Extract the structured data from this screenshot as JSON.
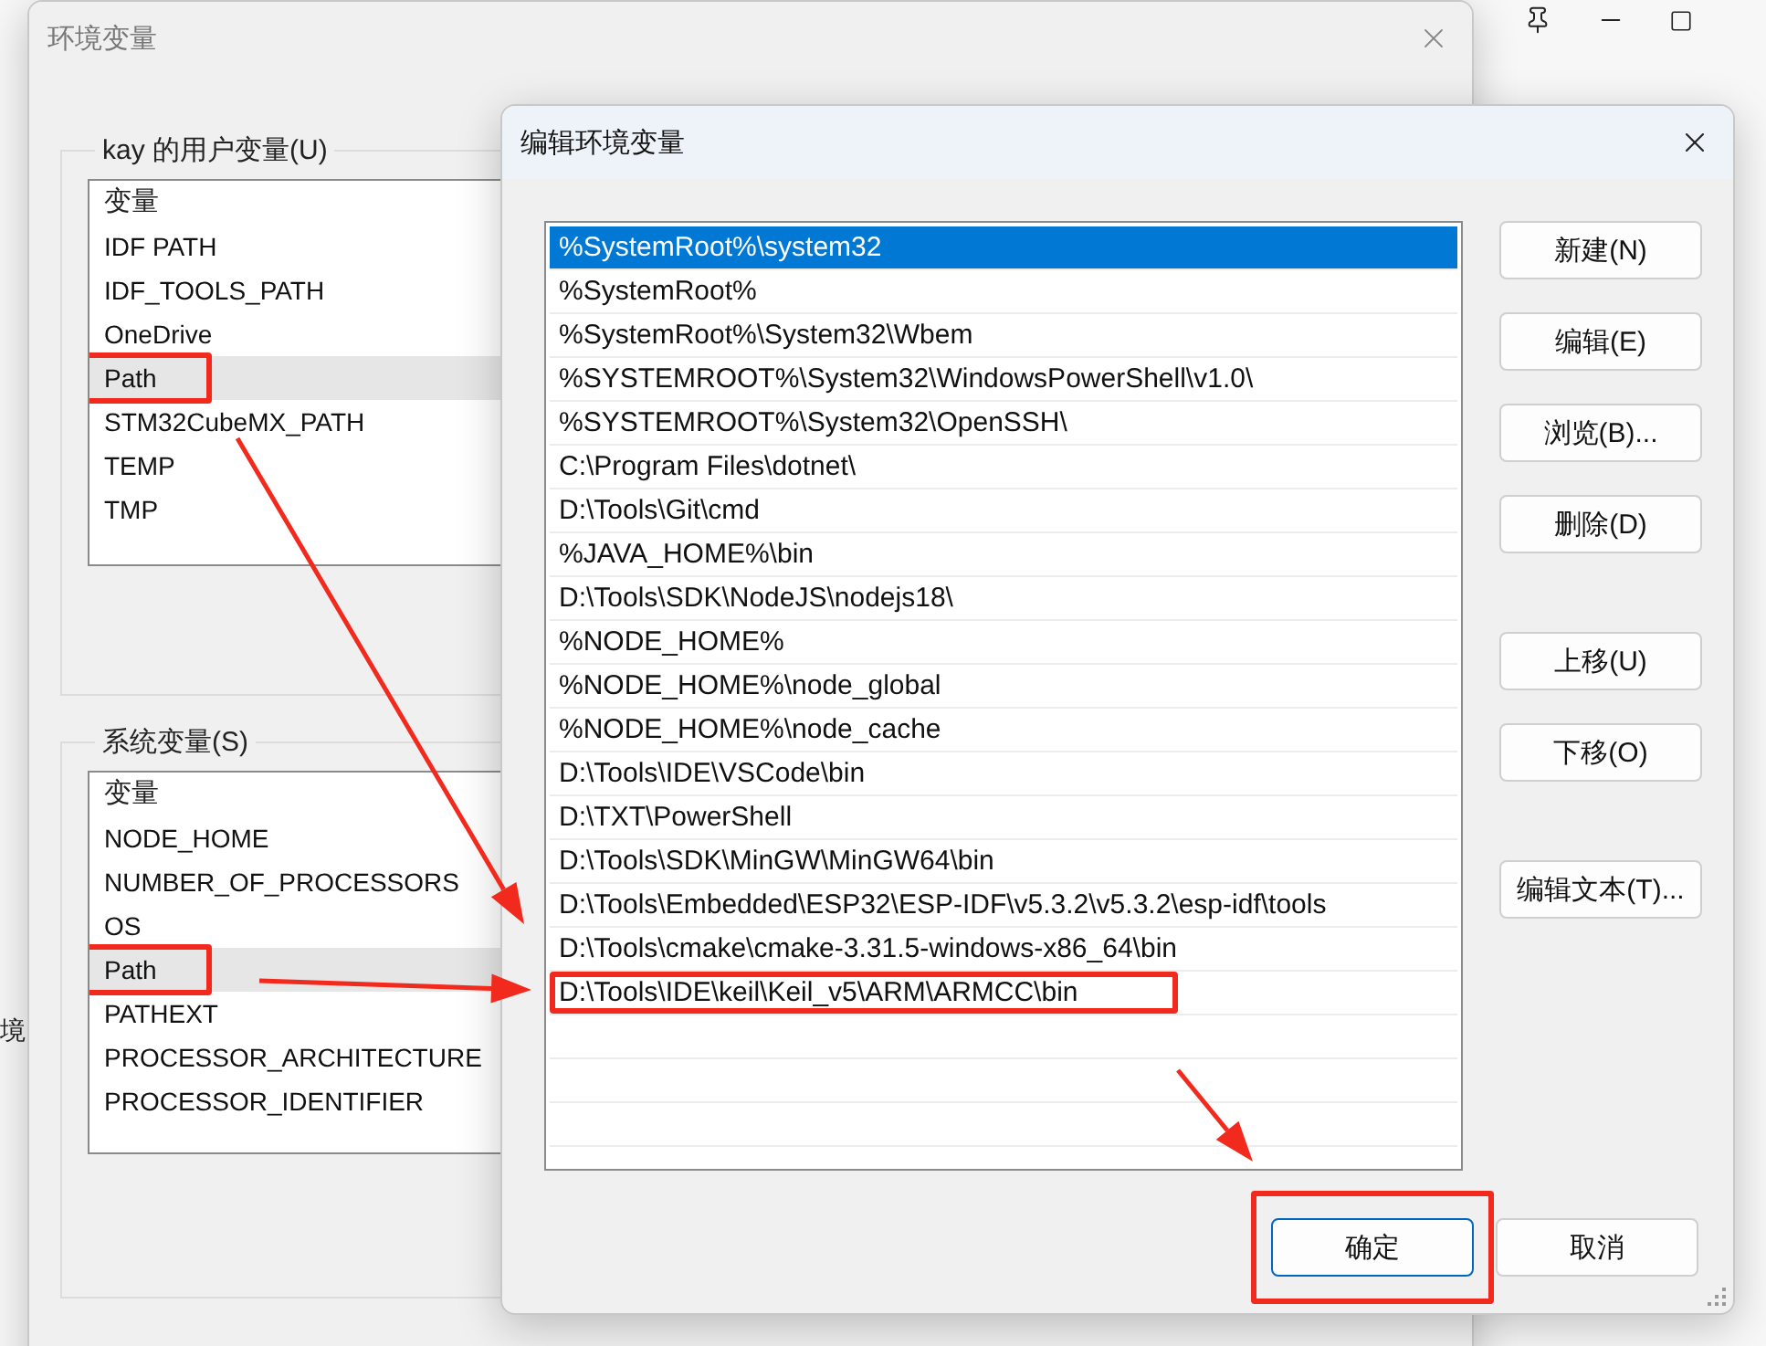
{
  "background_window": {
    "side_label": "境"
  },
  "env_window": {
    "title": "环境变量",
    "user_group": {
      "title": "kay 的用户变量(U)",
      "column": "变量",
      "rows": [
        {
          "name": "IDF PATH",
          "selected": false,
          "highlighted": false
        },
        {
          "name": "IDF_TOOLS_PATH",
          "selected": false,
          "highlighted": false
        },
        {
          "name": "OneDrive",
          "selected": false,
          "highlighted": false
        },
        {
          "name": "Path",
          "selected": true,
          "highlighted": true
        },
        {
          "name": "STM32CubeMX_PATH",
          "selected": false,
          "highlighted": false
        },
        {
          "name": "TEMP",
          "selected": false,
          "highlighted": false
        },
        {
          "name": "TMP",
          "selected": false,
          "highlighted": false
        }
      ]
    },
    "system_group": {
      "title": "系统变量(S)",
      "column": "变量",
      "rows": [
        {
          "name": "NODE_HOME",
          "selected": false,
          "highlighted": false
        },
        {
          "name": "NUMBER_OF_PROCESSORS",
          "selected": false,
          "highlighted": false
        },
        {
          "name": "OS",
          "selected": false,
          "highlighted": false
        },
        {
          "name": "Path",
          "selected": true,
          "highlighted": true
        },
        {
          "name": "PATHEXT",
          "selected": false,
          "highlighted": false
        },
        {
          "name": "PROCESSOR_ARCHITECTURE",
          "selected": false,
          "highlighted": false
        },
        {
          "name": "PROCESSOR_IDENTIFIER",
          "selected": false,
          "highlighted": false
        }
      ]
    }
  },
  "edit_dialog": {
    "title": "编辑环境变量",
    "entries": [
      {
        "text": "%SystemRoot%\\system32",
        "selected": true,
        "highlighted": false
      },
      {
        "text": "%SystemRoot%",
        "selected": false,
        "highlighted": false
      },
      {
        "text": "%SystemRoot%\\System32\\Wbem",
        "selected": false,
        "highlighted": false
      },
      {
        "text": "%SYSTEMROOT%\\System32\\WindowsPowerShell\\v1.0\\",
        "selected": false,
        "highlighted": false
      },
      {
        "text": "%SYSTEMROOT%\\System32\\OpenSSH\\",
        "selected": false,
        "highlighted": false
      },
      {
        "text": "C:\\Program Files\\dotnet\\",
        "selected": false,
        "highlighted": false
      },
      {
        "text": "D:\\Tools\\Git\\cmd",
        "selected": false,
        "highlighted": false
      },
      {
        "text": "%JAVA_HOME%\\bin",
        "selected": false,
        "highlighted": false
      },
      {
        "text": "D:\\Tools\\SDK\\NodeJS\\nodejs18\\",
        "selected": false,
        "highlighted": false
      },
      {
        "text": "%NODE_HOME%",
        "selected": false,
        "highlighted": false
      },
      {
        "text": "%NODE_HOME%\\node_global",
        "selected": false,
        "highlighted": false
      },
      {
        "text": "%NODE_HOME%\\node_cache",
        "selected": false,
        "highlighted": false
      },
      {
        "text": "D:\\Tools\\IDE\\VSCode\\bin",
        "selected": false,
        "highlighted": false
      },
      {
        "text": "D:\\TXT\\PowerShell",
        "selected": false,
        "highlighted": false
      },
      {
        "text": "D:\\Tools\\SDK\\MinGW\\MinGW64\\bin",
        "selected": false,
        "highlighted": false
      },
      {
        "text": "D:\\Tools\\Embedded\\ESP32\\ESP-IDF\\v5.3.2\\v5.3.2\\esp-idf\\tools",
        "selected": false,
        "highlighted": false
      },
      {
        "text": "D:\\Tools\\cmake\\cmake-3.31.5-windows-x86_64\\bin",
        "selected": false,
        "highlighted": false
      },
      {
        "text": "D:\\Tools\\IDE\\keil\\Keil_v5\\ARM\\ARMCC\\bin",
        "selected": false,
        "highlighted": true
      }
    ],
    "button_groups": [
      [
        "新建(N)",
        "编辑(E)",
        "浏览(B)...",
        "删除(D)"
      ],
      [
        "上移(U)",
        "下移(O)"
      ],
      [
        "编辑文本(T)..."
      ]
    ],
    "ok": {
      "label": "确定",
      "highlighted": true
    },
    "cancel": {
      "label": "取消"
    }
  }
}
